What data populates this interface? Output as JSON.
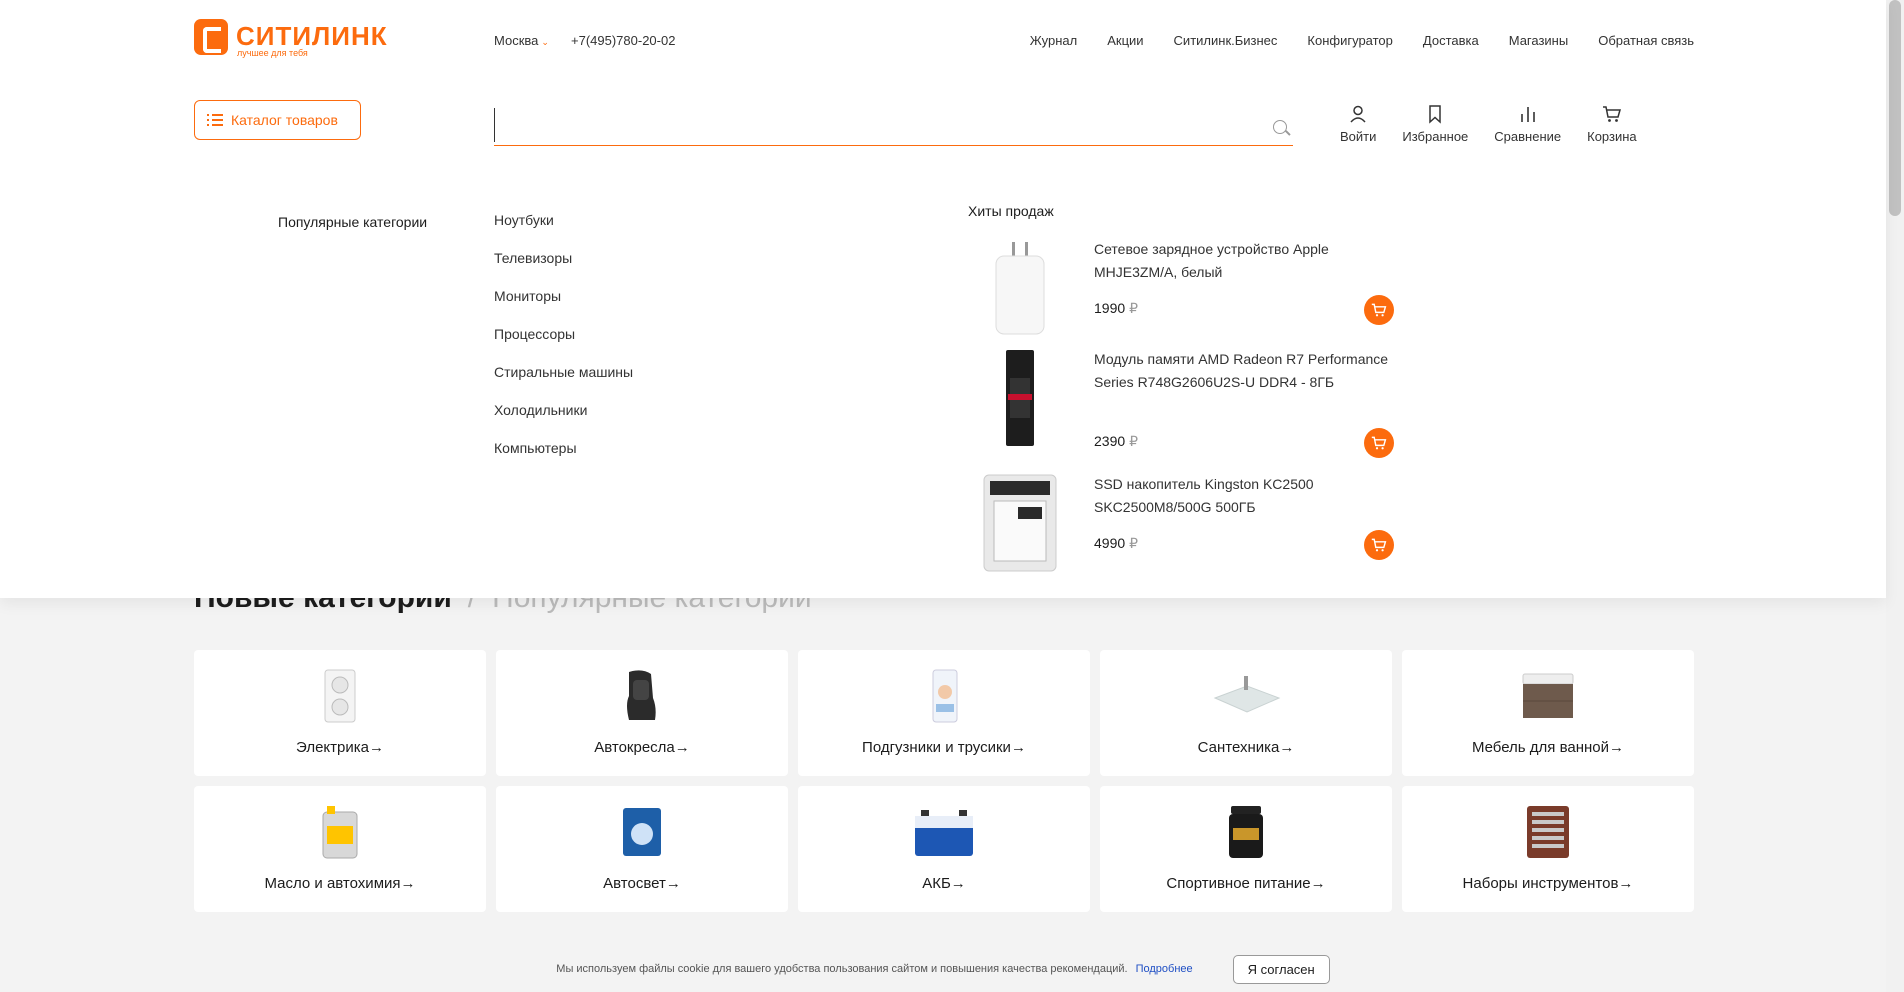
{
  "header": {
    "logo_name": "СИТИЛИНК",
    "logo_tagline": "лучшее для тебя",
    "city": "Москва",
    "phone": "+7(495)780-20-02",
    "nav": [
      "Журнал",
      "Акции",
      "Ситилинк.Бизнес",
      "Конфигуратор",
      "Доставка",
      "Магазины",
      "Обратная связь"
    ],
    "catalog_label": "Каталог товаров",
    "search_value": "",
    "actions": {
      "login": "Войти",
      "favorites": "Избранное",
      "compare": "Сравнение",
      "cart": "Корзина"
    },
    "accent_color": "#fc6b0e"
  },
  "dropdown": {
    "popular_title": "Популярные категории",
    "popular": [
      "Ноутбуки",
      "Телевизоры",
      "Мониторы",
      "Процессоры",
      "Стиральные машины",
      "Холодильники",
      "Компьютеры"
    ],
    "hits_title": "Хиты продаж",
    "hits": [
      {
        "name": "Сетевое зарядное устройство Apple MHJE3ZM/A, белый",
        "price": "1990",
        "currency": "₽"
      },
      {
        "name": "Модуль памяти AMD Radeon R7 Performance Series R748G2606U2S-U DDR4 - 8ГБ",
        "price": "2390",
        "currency": "₽"
      },
      {
        "name": "SSD накопитель Kingston KC2500 SKC2500M8/500G 500ГБ",
        "price": "4990",
        "currency": "₽"
      }
    ]
  },
  "main": {
    "title_active": "Новые категории",
    "title_sep": "/",
    "title_alt": "Популярные категории",
    "categories": [
      "Электрика→",
      "Автокресла→",
      "Подгузники и трусики→",
      "Сантехника→",
      "Мебель для ванной→",
      "Масло и автохимия→",
      "Автосвет→",
      "АКБ→",
      "Спортивное питание→",
      "Наборы инструментов→"
    ]
  },
  "cookie": {
    "text": "Мы используем файлы cookie для вашего удобства пользования сайтом и повышения качества рекомендаций.",
    "more": "Подробнее",
    "agree": "Я согласен"
  }
}
